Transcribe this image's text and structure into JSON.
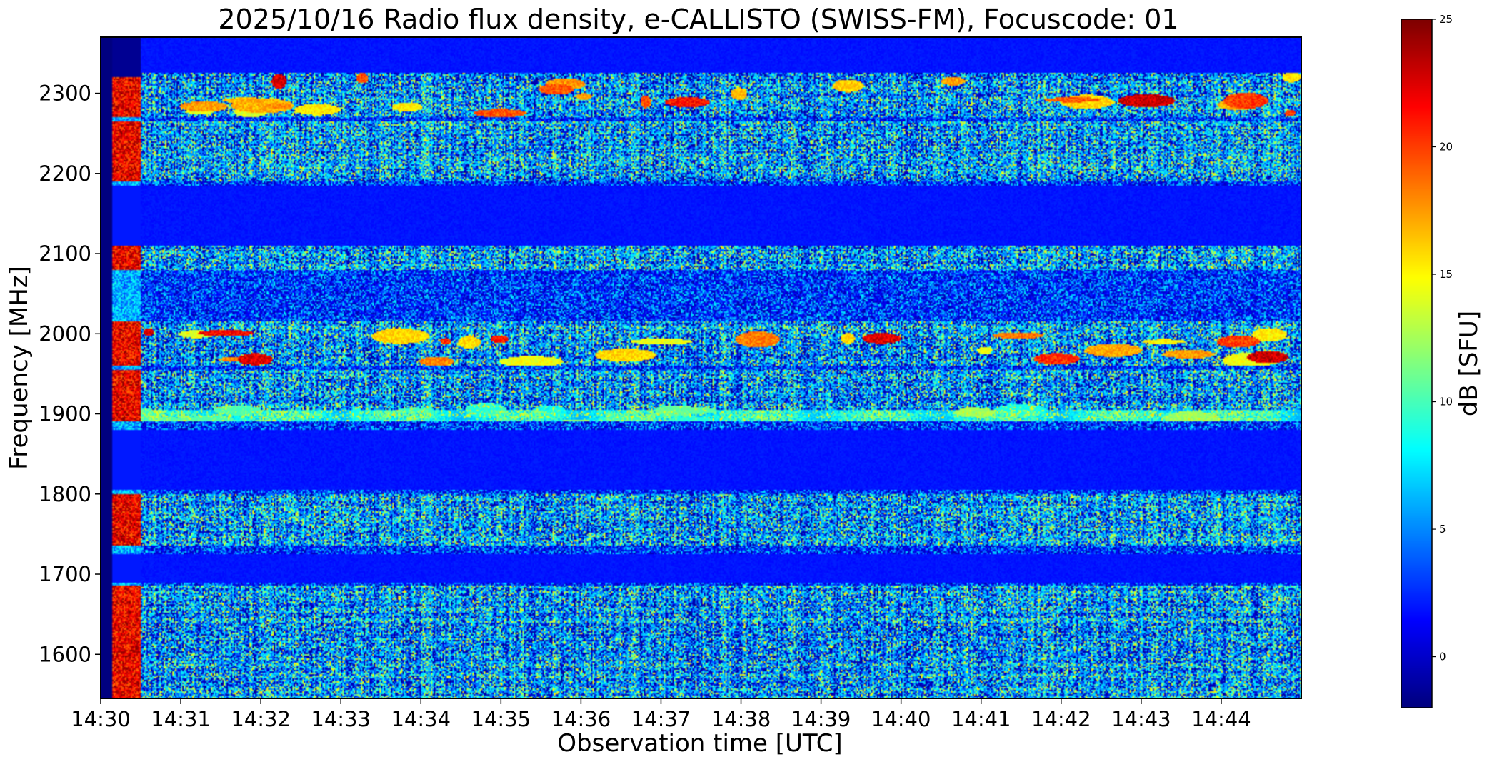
{
  "chart_data": {
    "type": "heatmap",
    "title": "2025/10/16  Radio flux density, e-CALLISTO (SWISS-FM), Focuscode: 01",
    "xlabel": "Observation time [UTC]",
    "ylabel": "Frequency [MHz]",
    "x_tick_labels": [
      "14:30",
      "14:31",
      "14:32",
      "14:33",
      "14:34",
      "14:35",
      "14:36",
      "14:37",
      "14:38",
      "14:39",
      "14:40",
      "14:41",
      "14:42",
      "14:43",
      "14:44"
    ],
    "x_range_minutes": [
      0,
      15
    ],
    "y_ticks": [
      1600,
      1700,
      1800,
      1900,
      2000,
      2100,
      2200,
      2300
    ],
    "ylim": [
      1545,
      2370
    ],
    "colormap": "jet",
    "colorbar": {
      "label": "dB [SFU]",
      "ticks": [
        0,
        5,
        10,
        15,
        20,
        25
      ],
      "range": [
        -2,
        25
      ]
    },
    "quiet_bands_mhz": [
      [
        2110,
        2185
      ],
      [
        1805,
        1880
      ],
      [
        1690,
        1725
      ],
      [
        2325,
        2370
      ]
    ],
    "active_bands_mhz": [
      [
        2270,
        2325
      ],
      [
        2190,
        2265
      ],
      [
        2080,
        2110
      ],
      [
        1960,
        2015
      ],
      [
        1890,
        1955
      ],
      [
        1735,
        1800
      ],
      [
        1545,
        1685
      ]
    ],
    "intense_strips": [
      {
        "freq_range": [
          2275,
          2320
        ],
        "peak_db": 25
      },
      {
        "freq_range": [
          1965,
          2005
        ],
        "peak_db": 25
      },
      {
        "freq_range": [
          1885,
          1905
        ],
        "peak_db": 14
      }
    ],
    "initial_burst": {
      "time_minutes": [
        0.15,
        0.5
      ],
      "freq_range": [
        1545,
        2320
      ],
      "peak_db": 25
    }
  }
}
